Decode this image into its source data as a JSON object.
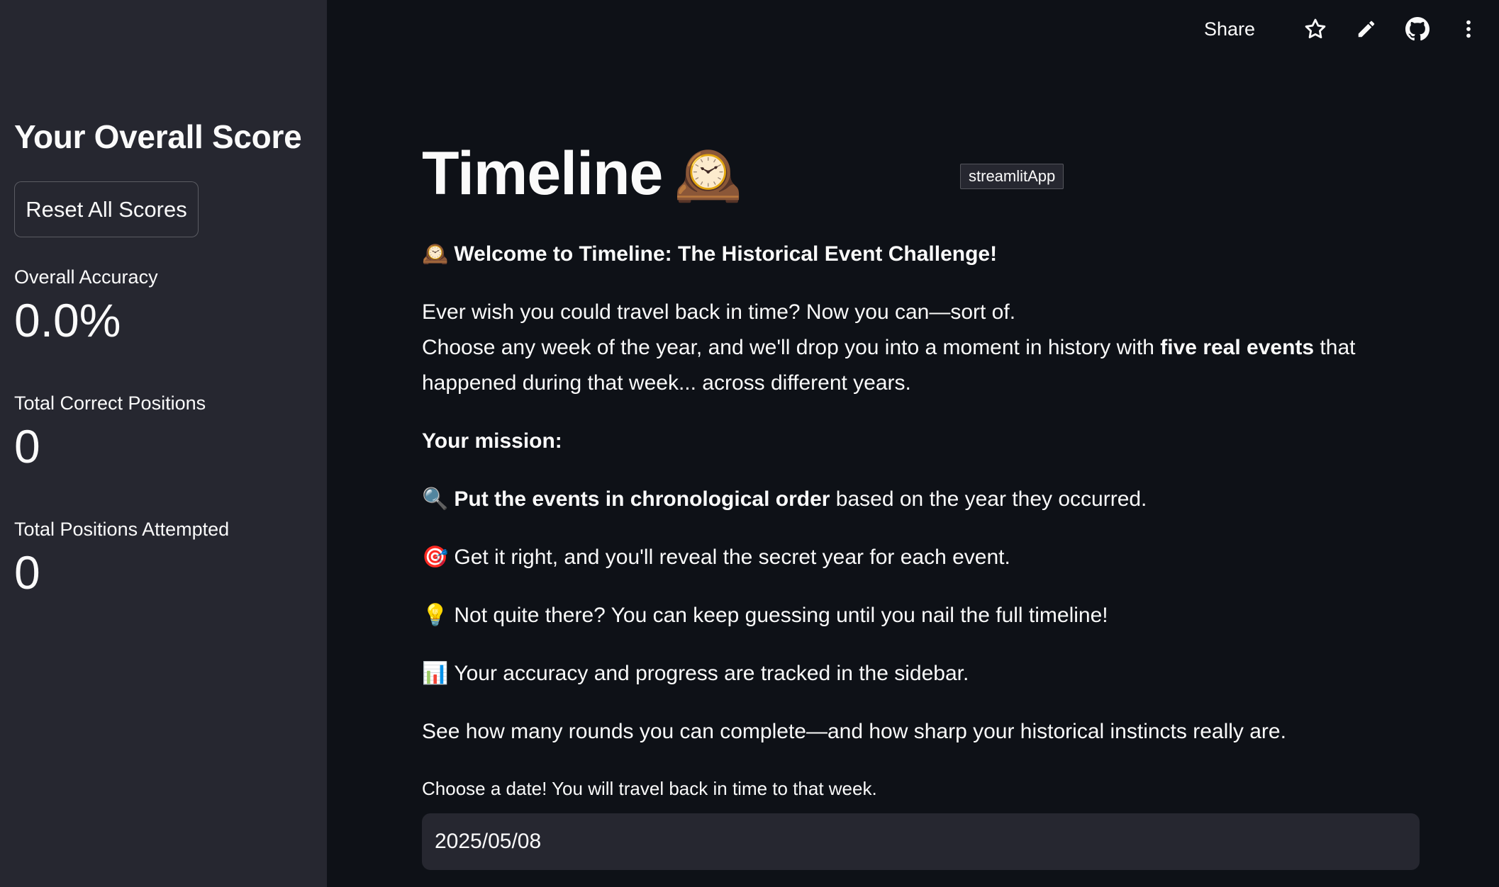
{
  "sidebar": {
    "title": "Your Overall Score",
    "reset_button": "Reset All Scores",
    "metrics": [
      {
        "label": "Overall Accuracy",
        "value": "0.0%"
      },
      {
        "label": "Total Correct Positions",
        "value": "0"
      },
      {
        "label": "Total Positions Attempted",
        "value": "0"
      }
    ]
  },
  "toolbar": {
    "share": "Share",
    "icons": [
      "star-icon",
      "pencil-icon",
      "github-icon",
      "more-vertical-icon"
    ]
  },
  "main": {
    "title": "Timeline",
    "title_emoji": "🕰️",
    "badge": "streamlitApp",
    "welcome_emoji": "🕰️",
    "welcome": "Welcome to Timeline: The Historical Event Challenge!",
    "intro_line1": "Ever wish you could travel back in time? Now you can—sort of.",
    "intro_line2_a": "Choose any week of the year, and we'll drop you into a moment in history with ",
    "intro_line2_bold": "five real events",
    "intro_line2_b": " that happened during that week... across different years.",
    "mission_heading": "Your mission:",
    "mission": [
      {
        "emoji": "🔍",
        "bold": "Put the events in chronological order",
        "text": " based on the year they occurred."
      },
      {
        "emoji": "🎯",
        "bold": "",
        "text": "Get it right, and you'll reveal the secret year for each event."
      },
      {
        "emoji": "💡",
        "bold": "",
        "text": "Not quite there? You can keep guessing until you nail the full timeline!"
      },
      {
        "emoji": "📊",
        "bold": "",
        "text": "Your accuracy and progress are tracked in the sidebar."
      }
    ],
    "closing": "See how many rounds you can complete—and how sharp your historical instincts really are.",
    "date_label": "Choose a date! You will travel back in time to that week.",
    "date_value": "2025/05/08"
  },
  "colors": {
    "main_bg": "#0e1117",
    "sidebar_bg": "#262730",
    "text": "#fafafa"
  }
}
